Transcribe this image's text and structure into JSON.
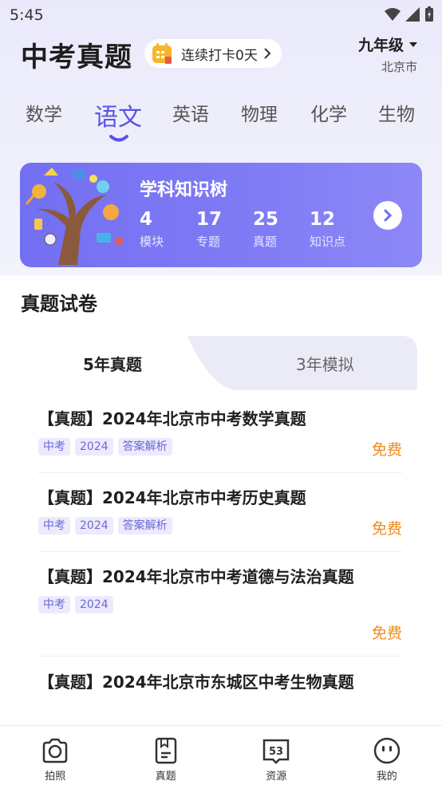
{
  "status_bar": {
    "time": "5:45"
  },
  "header": {
    "title": "中考真题",
    "checkin_label": "连续打卡0天",
    "grade": "九年级",
    "city": "北京市"
  },
  "subject_tabs": [
    {
      "label": "数学",
      "active": false
    },
    {
      "label": "语文",
      "active": true
    },
    {
      "label": "英语",
      "active": false
    },
    {
      "label": "物理",
      "active": false
    },
    {
      "label": "化学",
      "active": false
    },
    {
      "label": "生物",
      "active": false
    }
  ],
  "knowledge_tree": {
    "title": "学科知识树",
    "stats": [
      {
        "value": "4",
        "label": "模块"
      },
      {
        "value": "17",
        "label": "专题"
      },
      {
        "value": "25",
        "label": "真题"
      },
      {
        "value": "12",
        "label": "知识点"
      }
    ]
  },
  "papers": {
    "section_title": "真题试卷",
    "tabs": [
      {
        "label": "5年真题",
        "active": true
      },
      {
        "label": "3年模拟",
        "active": false
      }
    ],
    "items": [
      {
        "title": "【真题】2024年北京市中考数学真题",
        "tags": [
          "中考",
          "2024",
          "答案解析"
        ],
        "price": "免费"
      },
      {
        "title": "【真题】2024年北京市中考历史真题",
        "tags": [
          "中考",
          "2024",
          "答案解析"
        ],
        "price": "免费"
      },
      {
        "title": "【真题】2024年北京市中考道德与法治真题",
        "tags": [
          "中考",
          "2024"
        ],
        "price": "免费"
      },
      {
        "title": "【真题】2024年北京市东城区中考生物真题",
        "tags": [],
        "price": ""
      }
    ]
  },
  "bottom_nav": [
    {
      "label": "拍照",
      "icon": "camera-icon"
    },
    {
      "label": "真题",
      "icon": "paper-icon"
    },
    {
      "label": "资源",
      "icon": "resource-53-icon"
    },
    {
      "label": "我的",
      "icon": "profile-face-icon"
    }
  ],
  "colors": {
    "accent": "#5a54e6",
    "price": "#f08c1a",
    "card": "#7b77f3"
  }
}
